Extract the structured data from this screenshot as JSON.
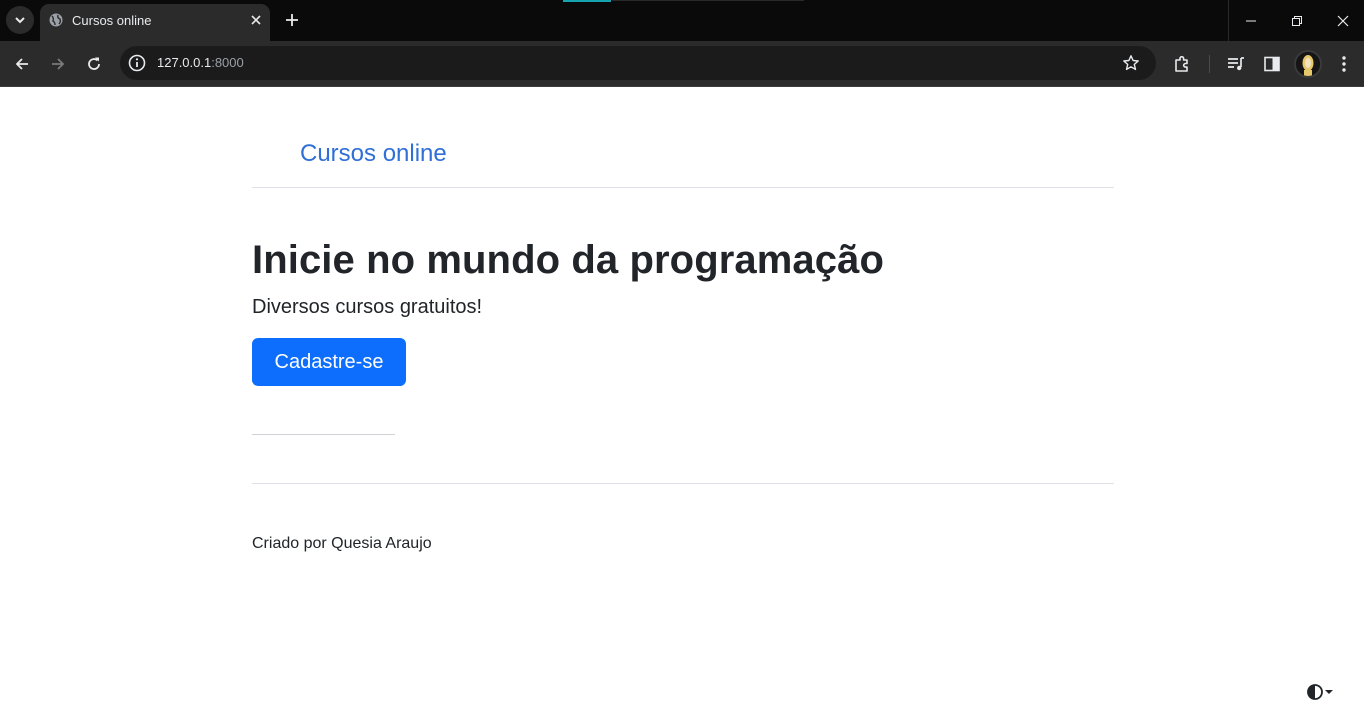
{
  "browser": {
    "tab": {
      "title": "Cursos online"
    },
    "address": {
      "host": "127.0.0.1",
      "port": ":8000"
    },
    "colors": {
      "chrome_bg": "#0a0a0a",
      "toolbar_bg": "#2b2b2b",
      "accent": "#16a4b0"
    }
  },
  "page": {
    "nav": {
      "brand": "Cursos online"
    },
    "hero": {
      "title": "Inicie no mundo da programação",
      "subtitle": "Diversos cursos gratuitos!",
      "cta_label": "Cadastre-se"
    },
    "footer": {
      "text": "Criado por Quesia Araujo"
    },
    "colors": {
      "link": "#2f6fd6",
      "primary_button": "#0d6efd",
      "text": "#212529"
    },
    "icons": [
      "theme-toggle-icon"
    ]
  }
}
